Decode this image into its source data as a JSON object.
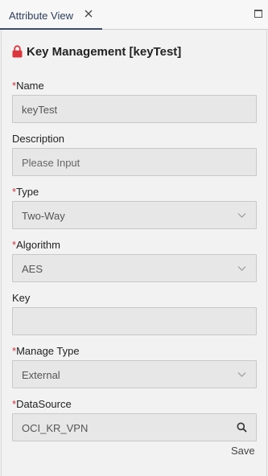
{
  "tab": {
    "label": "Attribute View"
  },
  "header": {
    "title": "Key Management [keyTest]"
  },
  "form": {
    "required_mark": "*",
    "name": {
      "label": "Name",
      "value": "keyTest"
    },
    "description": {
      "label": "Description",
      "placeholder": "Please Input"
    },
    "type": {
      "label": "Type",
      "value": "Two-Way"
    },
    "algorithm": {
      "label": "Algorithm",
      "value": "AES"
    },
    "key": {
      "label": "Key",
      "value": ""
    },
    "manage_type": {
      "label": "Manage Type",
      "value": "External"
    },
    "datasource": {
      "label": "DataSource",
      "value": "OCI_KR_VPN"
    }
  },
  "actions": {
    "save_label": "Save"
  },
  "colors": {
    "required": "#d0333a",
    "lock": "#d9363e",
    "tab_underline": "#3a4a6b"
  },
  "icons": [
    "close-icon",
    "maximize-icon",
    "lock-icon",
    "chevron-down-icon",
    "search-icon"
  ]
}
